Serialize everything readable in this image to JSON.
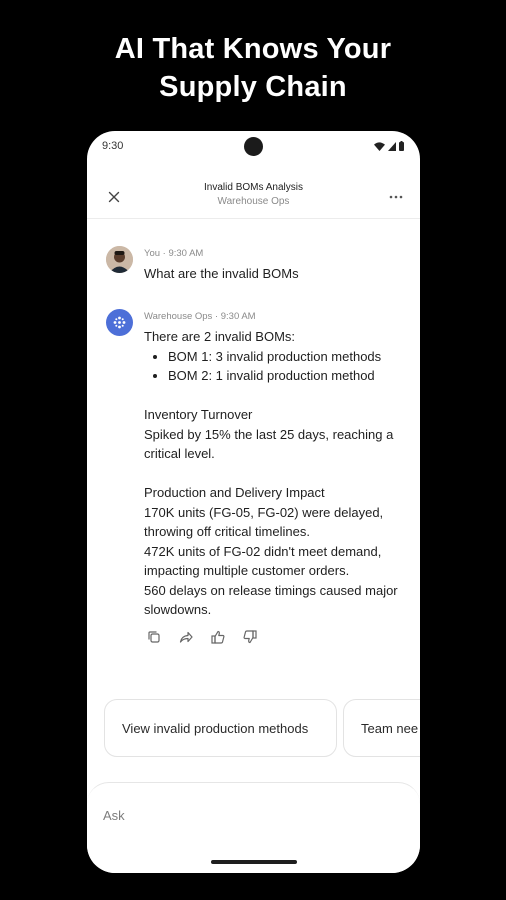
{
  "headline": {
    "line1": "AI That Knows Your",
    "line2": "Supply Chain"
  },
  "status_bar": {
    "time": "9:30"
  },
  "app_bar": {
    "title": "Invalid BOMs Analysis",
    "subtitle": "Warehouse Ops",
    "close_icon": "close-icon",
    "more_icon": "more-horizontal-icon"
  },
  "messages": [
    {
      "author": "user",
      "meta": "You · 9:30 AM",
      "text": "What are the invalid BOMs"
    },
    {
      "author": "bot",
      "meta": "Warehouse Ops · 9:30 AM",
      "intro": "There are 2 invalid BOMs:",
      "bullets": [
        "BOM 1: 3 invalid production methods",
        "BOM 2: 1 invalid production method"
      ],
      "inventory_heading": "Inventory Turnover",
      "inventory_text": "Spiked by 15% the last 25 days, reaching a critical level.",
      "impact_heading": "Production and Delivery Impact",
      "impact_lines": [
        "170K units (FG-05, FG-02) were delayed, throwing off critical timelines.",
        "472K units of FG-02 didn't meet demand, impacting multiple customer orders.",
        "560 delays on release timings caused major slowdowns."
      ]
    }
  ],
  "message_actions": [
    "copy-icon",
    "share-icon",
    "thumbs-up-icon",
    "thumbs-down-icon"
  ],
  "suggestions": [
    "View invalid production methods",
    "Team nee"
  ],
  "composer": {
    "placeholder": "Ask"
  },
  "colors": {
    "background": "#000000",
    "phone": "#ffffff",
    "bot_avatar": "#4d6fd8"
  }
}
